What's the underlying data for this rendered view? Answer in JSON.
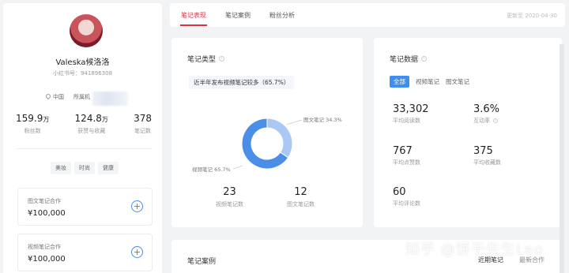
{
  "profile": {
    "name": "Valeska候洛洛",
    "redbook_id": "小红书号：941896308",
    "location": "中国",
    "org": "所属机",
    "stats": [
      {
        "value": "159.9",
        "unit": "万",
        "label": "粉丝数"
      },
      {
        "value": "124.8",
        "unit": "万",
        "label": "获赞与收藏"
      },
      {
        "value": "378",
        "unit": "",
        "label": "笔记数"
      }
    ],
    "tags": [
      "美妆",
      "时尚",
      "健康"
    ],
    "cards": [
      {
        "title": "图文笔记合作",
        "price": "¥100,000"
      },
      {
        "title": "视频笔记合作",
        "price": "¥100,000"
      }
    ]
  },
  "topbar": {
    "tabs": [
      "笔记表现",
      "笔记案例",
      "粉丝分析"
    ],
    "active_index": 0,
    "updated": "更新至 2020-04-30"
  },
  "note_type": {
    "title": "笔记类型",
    "summary": "近半年发布视频笔记较多（65.7%）",
    "label_image": "图文笔记 34.3%",
    "label_video": "视频笔记 65.7%",
    "counts": [
      {
        "value": "23",
        "label": "视频笔记数"
      },
      {
        "value": "12",
        "label": "图文笔记数"
      }
    ]
  },
  "chart_data": {
    "type": "pie",
    "categories": [
      "视频笔记",
      "图文笔记"
    ],
    "values": [
      65.7,
      34.3
    ],
    "colors": [
      "#4a8ee8",
      "#a9c8f4"
    ]
  },
  "note_data": {
    "title": "笔记数据",
    "segments": [
      "全部",
      "视频笔记",
      "图文笔记"
    ],
    "metrics": [
      {
        "value": "33,302",
        "label": "平均阅读数"
      },
      {
        "value": "3.6%",
        "label": "互动率"
      },
      {
        "value": "767",
        "label": "平均点赞数"
      },
      {
        "value": "375",
        "label": "平均收藏数"
      },
      {
        "value": "60",
        "label": "平均评论数"
      }
    ]
  },
  "cases": {
    "title": "笔记案例",
    "tabs": [
      "近期笔记",
      "最新合作"
    ]
  },
  "watermark": "知乎 @饼干先生Leo"
}
